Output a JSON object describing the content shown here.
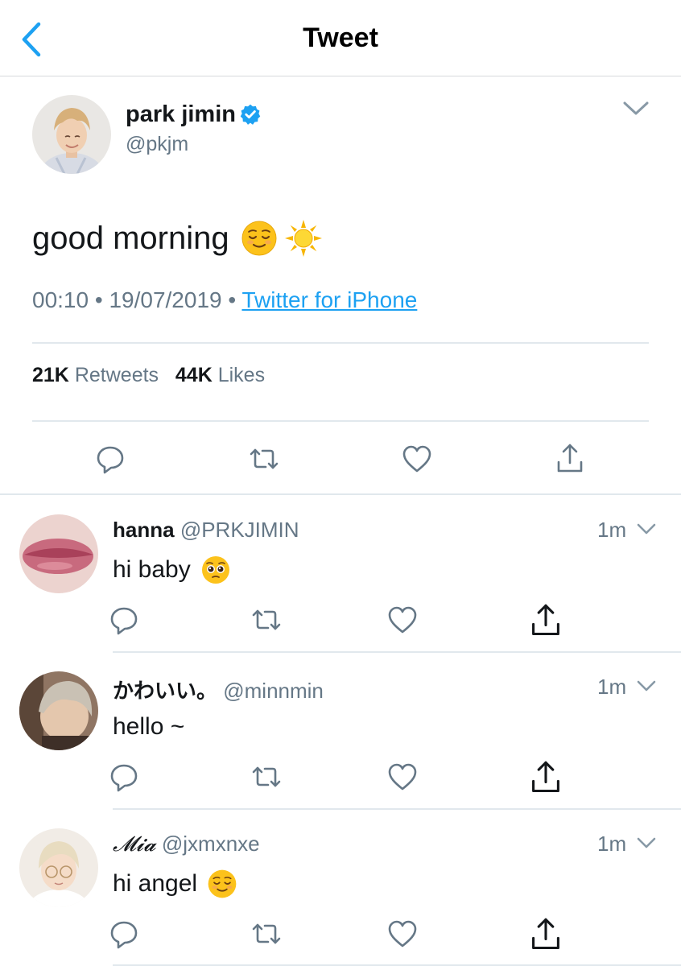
{
  "header": {
    "title": "Tweet"
  },
  "tweet": {
    "author_name": "park jimin",
    "author_handle": "@pkjm",
    "text": "good morning",
    "emojis": [
      "relieved-face",
      "sun"
    ],
    "time": "00:10",
    "date": "19/07/2019",
    "separator": "•",
    "source": "Twitter for iPhone",
    "retweets_count": "21K",
    "retweets_label": "Retweets",
    "likes_count": "44K",
    "likes_label": "Likes"
  },
  "replies": [
    {
      "name": "hanna",
      "handle": "@PRKJIMIN",
      "time": "1m",
      "text": "hi baby",
      "emoji": "pleading-face"
    },
    {
      "name": "かわいい。",
      "handle": "@minnmin",
      "time": "1m",
      "text": "hello ~",
      "emoji": ""
    },
    {
      "name": "𝓜𝓲𝓪",
      "handle": "@jxmxnxe",
      "time": "1m",
      "text": "hi angel",
      "emoji": "relieved-face"
    }
  ],
  "colors": {
    "accent": "#1da1f2",
    "muted": "#657786",
    "text": "#14171a",
    "divider": "#e1e8ed"
  }
}
